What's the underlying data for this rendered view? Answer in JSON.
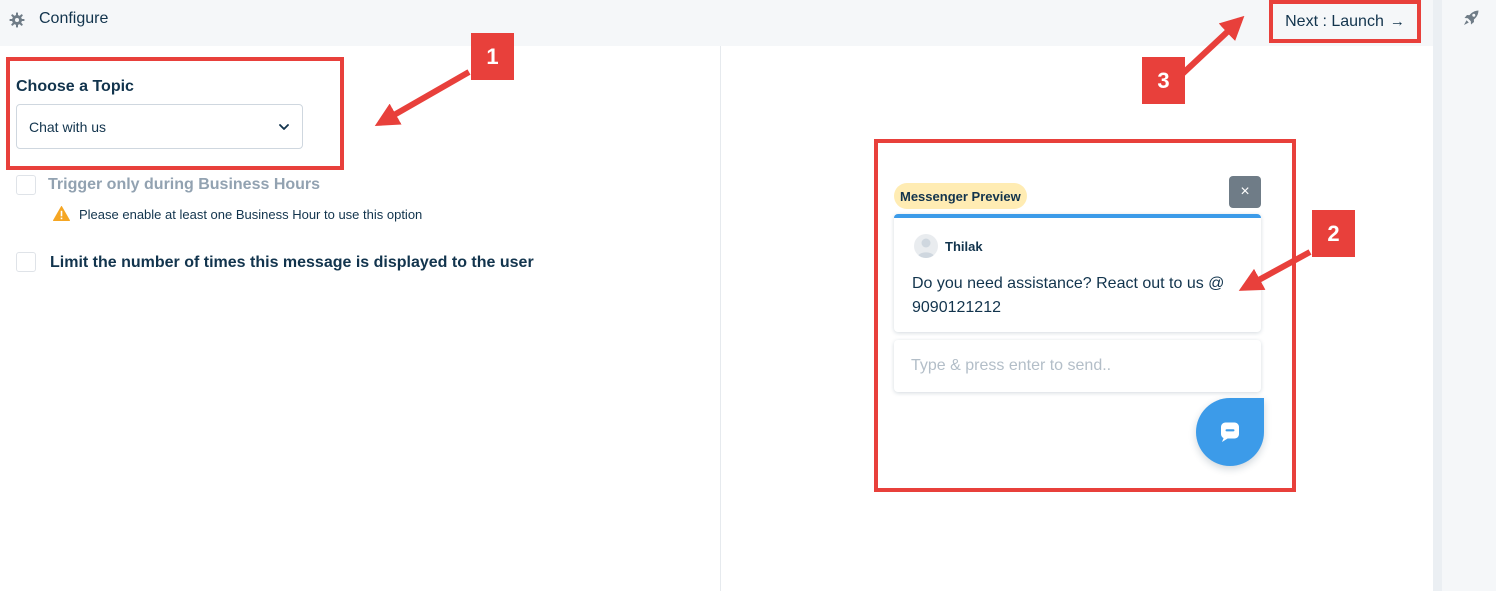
{
  "topbar": {
    "title": "Configure",
    "icon": "gear-icon",
    "next_button_label": "Next : Launch",
    "next_button_arrow": "→"
  },
  "rail": {
    "icon": "rocket-icon"
  },
  "form": {
    "topic_label": "Choose a Topic",
    "topic_selected": "Chat with us",
    "business_hours_label": "Trigger only during Business Hours",
    "business_hours_checked": false,
    "business_hours_warning": "Please enable at least one Business Hour to use this option",
    "limit_label": "Limit the number of times this message is displayed to the user",
    "limit_checked": false
  },
  "preview": {
    "badge": "Messenger Preview",
    "close_glyph": "×",
    "sender": "Thilak",
    "message": "Do you need assistance? React out to us @ 9090121212",
    "reply_placeholder": "Type & press enter to send..",
    "launcher_icon": "chat-bubble-icon"
  },
  "callouts": [
    "1",
    "2",
    "3"
  ],
  "colors": {
    "highlight": "#e8403b",
    "accent_blue": "#3c9be9",
    "badge_bg": "#ffecb3",
    "warning": "#f5a623",
    "text_dark": "#12344d",
    "text_muted": "#92a2b1"
  }
}
